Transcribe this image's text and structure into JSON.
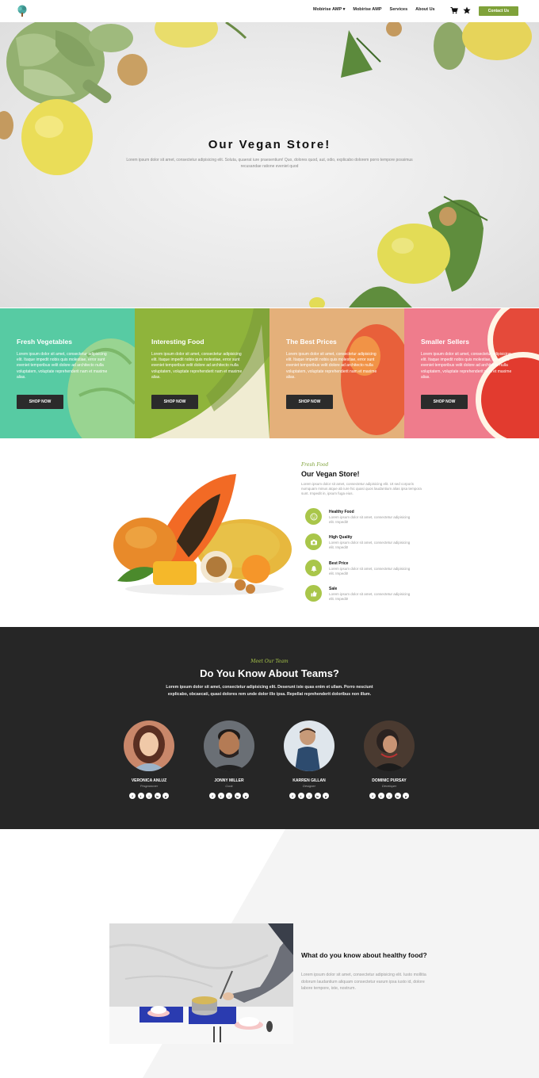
{
  "nav": {
    "logo_icon": "tree-logo-icon",
    "links": [
      "Mobirise AMP ▾",
      "Mobirise AMP",
      "Services",
      "About Us"
    ],
    "icons": [
      "cart-icon",
      "star-icon"
    ],
    "cta_label": "Contact Us"
  },
  "hero": {
    "title": "Our Vegan Store!",
    "subtitle": "Lorem ipsum dolor sit amet, consectetur adipisicing elit. Soluta, quaerat iure praesentium! Quo, dolores quod, aut, odio, explicabo dolorem porro tempore possimus recusandae ratione eveniet quod"
  },
  "cards": [
    {
      "title": "Fresh Vegetables",
      "text": "Lorem ipsum dolor sit amet, consectetur adipisicing elit. Itaque impedit nobis quis molestiae, error sunt eveniet temporibus velit dolore ad architecto nulla voluptatem, voluptate reprehenderit nam et maxime alias.",
      "button": "SHOP NOW",
      "color": "#57cba3"
    },
    {
      "title": "Interesting Food",
      "text": "Lorem ipsum dolor sit amet, consectetur adipisicing elit. Itaque impedit nobis quis molestiae, error sunt eveniet temporibus velit dolore ad architecto nulla voluptatem, voluptate reprehenderit nam et maxime alias.",
      "button": "SHOP NOW",
      "color": "#8fb43b"
    },
    {
      "title": "The Best Prices",
      "text": "Lorem ipsum dolor sit amet, consectetur adipisicing elit. Itaque impedit nobis quis molestiae, error sunt eveniet temporibus velit dolore ad architecto nulla voluptatem, voluptate reprehenderit nam et maxime alias.",
      "button": "SHOP NOW",
      "color": "#e4b07a"
    },
    {
      "title": "Smaller Sellers",
      "text": "Lorem ipsum dolor sit amet, consectetur adipisicing elit. Itaque impedit nobis quis molestiae, error sunt eveniet temporibus velit dolore ad architecto nulla voluptatem, voluptate reprehenderit nam et maxime alias.",
      "button": "SHOP NOW",
      "color": "#ef7c8c"
    }
  ],
  "about": {
    "kicker": "Fresh Food",
    "title": "Our Vegan Store!",
    "text": "Lorem ipsum dolor sit amet, consectetur adipisicing elit. Ut sed corporis numquam minus atque ab iure hic quasi quos laudantium alias ipsa tempora sunt. Impedit in, ipsum fuga eius.",
    "features": [
      {
        "title": "Healthy Food",
        "text": "Lorem ipsum dolor sit amet, consectetur adipisicing elit. Impedit!",
        "icon": "smile-icon"
      },
      {
        "title": "High Quality",
        "text": "Lorem ipsum dolor sit amet, consectetur adipisicing elit. Impedit!",
        "icon": "camera-icon"
      },
      {
        "title": "Best Price",
        "text": "Lorem ipsum dolor sit amet, consectetur adipisicing elit. Impedit!",
        "icon": "bell-icon"
      },
      {
        "title": "Sale",
        "text": "Lorem ipsum dolor sit amet, consectetur adipisicing elit. Impedit!",
        "icon": "thumbs-up-icon"
      }
    ]
  },
  "team": {
    "kicker": "Meet Our Team",
    "title": "Do You Know About Teams?",
    "text": "Lorem ipsum dolor sit amet, consectetur adipisicing elit. Deserunt iste quas enim et ullam. Porro nesciunt explicabo, obcaecati, quasi dolores rem unde dolor illo ipsa. Repellat reprehenderit doloribus non illum.",
    "members": [
      {
        "name": "VERONICA ANLUZ",
        "role": "Programmer"
      },
      {
        "name": "JONNY MILLER",
        "role": "Cook"
      },
      {
        "name": "KARREN GILLAN",
        "role": "Designer"
      },
      {
        "name": "DOMINIC PURSAY",
        "role": "Developer"
      }
    ],
    "social_icons": [
      "facebook-icon",
      "twitter-icon",
      "instagram-icon",
      "linkedin-icon",
      "pinterest-icon"
    ]
  },
  "health": {
    "title": "What do you know about healthy food?",
    "text": "Lorem ipsum dolor sit amet, consectetur adipisicing elit. Iusto mollitia dolorum laudantium aliquam consectetur earum ipsa iusto id, dolore labore tempore, iste, nostrum."
  }
}
